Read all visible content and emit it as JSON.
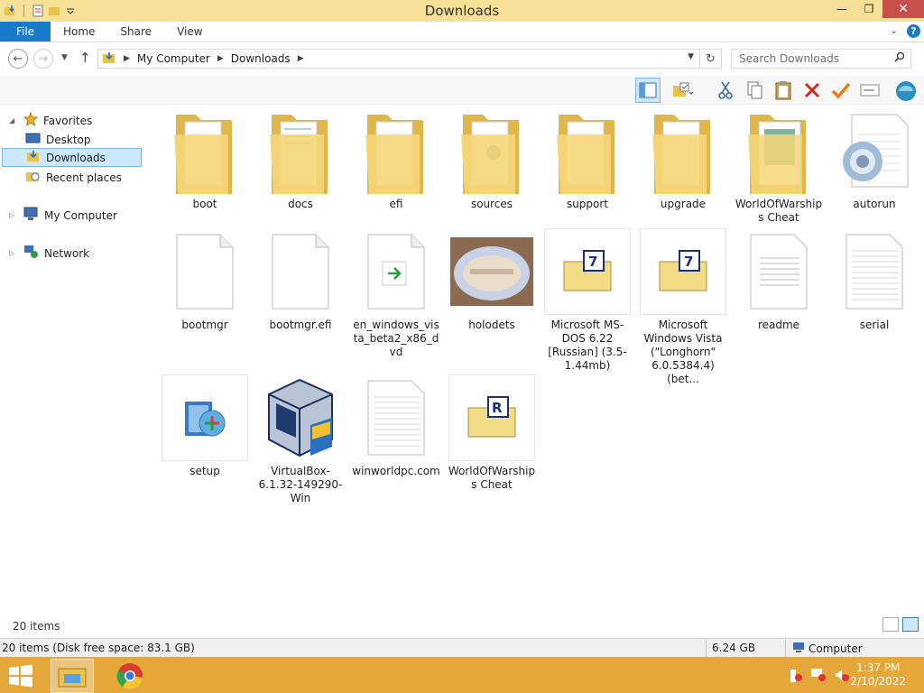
{
  "window": {
    "title": "Downloads"
  },
  "ribbon": {
    "file": "File",
    "tabs": [
      "Home",
      "Share",
      "View"
    ]
  },
  "address": {
    "crumbs": [
      "My Computer",
      "Downloads"
    ]
  },
  "search": {
    "placeholder": "Search Downloads"
  },
  "sidebar": {
    "favorites": "Favorites",
    "desktop": "Desktop",
    "downloads": "Downloads",
    "recent": "Recent places",
    "computer": "My Computer",
    "network": "Network"
  },
  "files": [
    {
      "name": "boot",
      "kind": "folder"
    },
    {
      "name": "docs",
      "kind": "folder"
    },
    {
      "name": "efi",
      "kind": "folder"
    },
    {
      "name": "sources",
      "kind": "folder"
    },
    {
      "name": "support",
      "kind": "folder"
    },
    {
      "name": "upgrade",
      "kind": "folder"
    },
    {
      "name": "WorldOfWarships Cheat",
      "kind": "folder"
    },
    {
      "name": "autorun",
      "kind": "settings-file"
    },
    {
      "name": "bootmgr",
      "kind": "blank-file"
    },
    {
      "name": "bootmgr.efi",
      "kind": "blank-file"
    },
    {
      "name": "en_windows_vista_beta2_x86_dvd",
      "kind": "shortcut-file"
    },
    {
      "name": "holodets",
      "kind": "image-thumbnail"
    },
    {
      "name": "Microsoft MS-DOS 6.22 [Russian] (3.5-1.44mb)",
      "kind": "7z-archive"
    },
    {
      "name": "Microsoft Windows Vista (\"Longhorn\" 6.0.5384.4) (bet...",
      "kind": "7z-archive"
    },
    {
      "name": "readme",
      "kind": "text-file"
    },
    {
      "name": "serial",
      "kind": "text-file"
    },
    {
      "name": "setup",
      "kind": "installer"
    },
    {
      "name": "VirtualBox-6.1.32-149290-Win",
      "kind": "virtualbox-installer"
    },
    {
      "name": "winworldpc.com",
      "kind": "text-file"
    },
    {
      "name": "WorldOfWarships Cheat",
      "kind": "rar-archive"
    }
  ],
  "status": {
    "count": "20 items",
    "detail": "20 items (Disk free space: 83.1 GB)",
    "size": "6.24 GB",
    "location": "Computer"
  },
  "taskbar": {
    "time": "1:37 PM",
    "date": "2/10/2022"
  },
  "colors": {
    "titlebar": "#f5e096",
    "file_tab": "#1979ca",
    "taskbar": "#e5a63a",
    "selection": "#cce8ff"
  }
}
